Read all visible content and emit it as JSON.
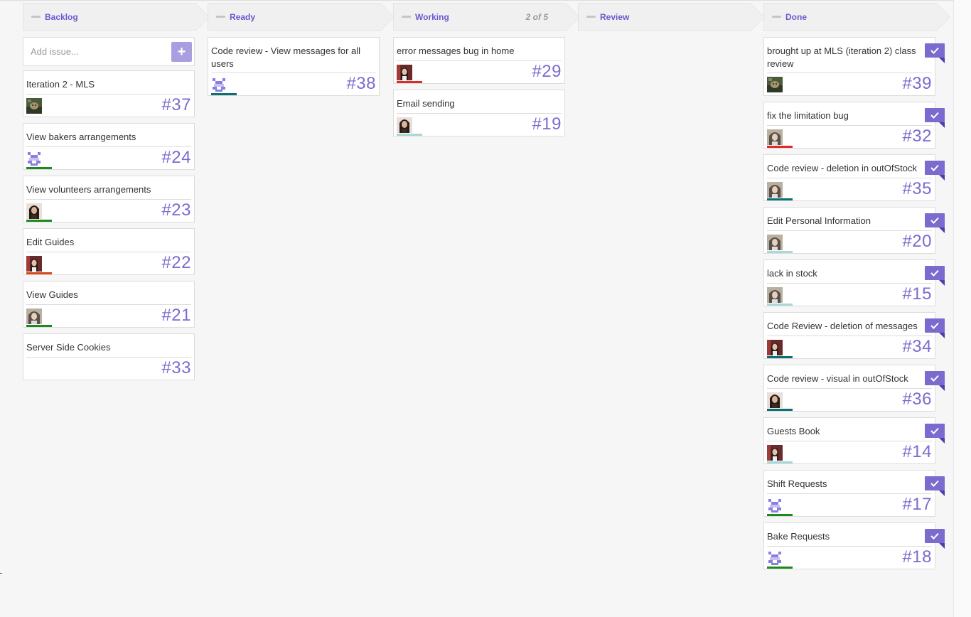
{
  "colors": {
    "accent": "#7b6bcf",
    "green": "#1a8a1a",
    "teal": "#0b6f73",
    "red": "#e02a2a",
    "orange": "#d4491a",
    "lightteal": "#a8d8d8"
  },
  "board": {
    "columns": [
      {
        "title": "Backlog",
        "count": "",
        "add_issue": {
          "placeholder": "Add issue...",
          "button": "+"
        },
        "cards": [
          {
            "title": "Iteration 2 - MLS",
            "number": "#37",
            "avatar": "avatar-photo-dog",
            "bar": ""
          },
          {
            "title": "View bakers arrangements",
            "number": "#24",
            "avatar": "avatar-identicon",
            "bar": "green"
          },
          {
            "title": "View volunteers arrangements",
            "number": "#23",
            "avatar": "avatar-photo-woman",
            "bar": "green"
          },
          {
            "title": "Edit Guides",
            "number": "#22",
            "avatar": "avatar-photo-woman-red",
            "bar": "orange"
          },
          {
            "title": "View Guides",
            "number": "#21",
            "avatar": "avatar-photo-woman-veil",
            "bar": "green"
          },
          {
            "title": "Server Side Cookies",
            "number": "#33",
            "avatar": "",
            "bar": ""
          }
        ]
      },
      {
        "title": "Ready",
        "count": "",
        "cards": [
          {
            "title": "Code review - View messages for all users",
            "number": "#38",
            "avatar": "avatar-identicon",
            "bar": "teal",
            "tall": true
          }
        ]
      },
      {
        "title": "Working",
        "count": "2 of 5",
        "cards": [
          {
            "title": "error messages bug in home",
            "number": "#29",
            "avatar": "avatar-photo-woman-red",
            "bar": "red"
          },
          {
            "title": "Email sending",
            "number": "#19",
            "avatar": "avatar-photo-woman",
            "bar": "lightteal"
          }
        ]
      },
      {
        "title": "Review",
        "count": "",
        "cards": []
      },
      {
        "title": "Done",
        "count": "",
        "cards": [
          {
            "title": "brought up at MLS (iteration 2) class review",
            "number": "#39",
            "avatar": "avatar-photo-dog",
            "bar": "",
            "tall": true,
            "done": true
          },
          {
            "title": "fix the limitation bug",
            "number": "#32",
            "avatar": "avatar-photo-woman-veil",
            "bar": "red",
            "done": true
          },
          {
            "title": "Code review - deletion in outOfStock",
            "number": "#35",
            "avatar": "avatar-photo-woman-veil",
            "bar": "teal",
            "done": true
          },
          {
            "title": "Edit Personal Information",
            "number": "#20",
            "avatar": "avatar-photo-woman-veil",
            "bar": "lightteal",
            "done": true
          },
          {
            "title": "lack in stock",
            "number": "#15",
            "avatar": "avatar-photo-woman-veil",
            "bar": "lightteal",
            "done": true
          },
          {
            "title": "Code Review - deletion of messages",
            "number": "#34",
            "avatar": "avatar-photo-woman-red",
            "bar": "teal",
            "done": true
          },
          {
            "title": "Code review - visual in outOfStock",
            "number": "#36",
            "avatar": "avatar-photo-woman",
            "bar": "teal",
            "done": true
          },
          {
            "title": "Guests Book",
            "number": "#14",
            "avatar": "avatar-photo-woman-red",
            "bar": "lightteal",
            "done": true
          },
          {
            "title": "Shift Requests",
            "number": "#17",
            "avatar": "avatar-identicon",
            "bar": "green",
            "done": true
          },
          {
            "title": "Bake Requests",
            "number": "#18",
            "avatar": "avatar-identicon",
            "bar": "green",
            "done": true
          }
        ]
      }
    ]
  }
}
